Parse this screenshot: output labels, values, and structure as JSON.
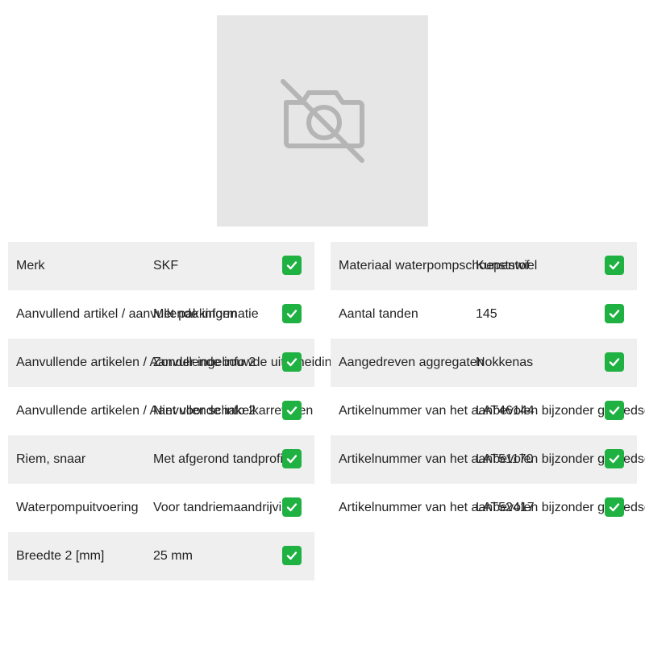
{
  "image": {
    "icon": "no-photo-camera-icon"
  },
  "left_specs": [
    {
      "label": "Merk",
      "value": "SKF",
      "status_icon": "green-check-icon"
    },
    {
      "label": "Aanvullend artikel / aanvullende informatie",
      "value": "Met pakkingen",
      "status_icon": "green-check-icon"
    },
    {
      "label": "Aanvullende artikelen / Aanvullende info 2",
      "value": "Zonder ingebouwde uitscheiding",
      "status_icon": "green-check-icon"
    },
    {
      "label": "Aanvullende artikelen / Aanvullende info 2",
      "value": "Niet voor schakelkarrevaten",
      "status_icon": "green-check-icon"
    },
    {
      "label": "Riem, snaar",
      "value": "Met afgerond tandprofiel",
      "status_icon": "green-check-icon"
    },
    {
      "label": "Waterpompuitvoering",
      "value": "Voor tandriemaandrijving",
      "status_icon": "green-check-icon"
    },
    {
      "label": "Breedte 2 [mm]",
      "value": "25 mm",
      "status_icon": "green-check-icon"
    }
  ],
  "right_specs": [
    {
      "label": "Materiaal waterpompschoepenwiel",
      "value": "Kunststof",
      "status_icon": "green-check-icon"
    },
    {
      "label": "Aantal tanden",
      "value": "145",
      "status_icon": "green-check-icon"
    },
    {
      "label": "Aangedreven aggregaten",
      "value": "Nokkenas",
      "status_icon": "green-check-icon"
    },
    {
      "label": "Artikelnummer van het aanbevolen bijzonder gereedschap",
      "value": "LAT46144",
      "status_icon": "green-check-icon"
    },
    {
      "label": "Artikelnummer van het aanbevolen bijzonder gereedschap",
      "value": "LAT51170",
      "status_icon": "green-check-icon"
    },
    {
      "label": "Artikelnummer van het aanbevolen bijzonder gereedschap",
      "value": "LAT52417",
      "status_icon": "green-check-icon"
    }
  ],
  "colors": {
    "row_alt_background": "#efefef",
    "check_green": "#1fb141",
    "placeholder_background": "#e6e6e6",
    "placeholder_icon": "#b5b5b5"
  }
}
